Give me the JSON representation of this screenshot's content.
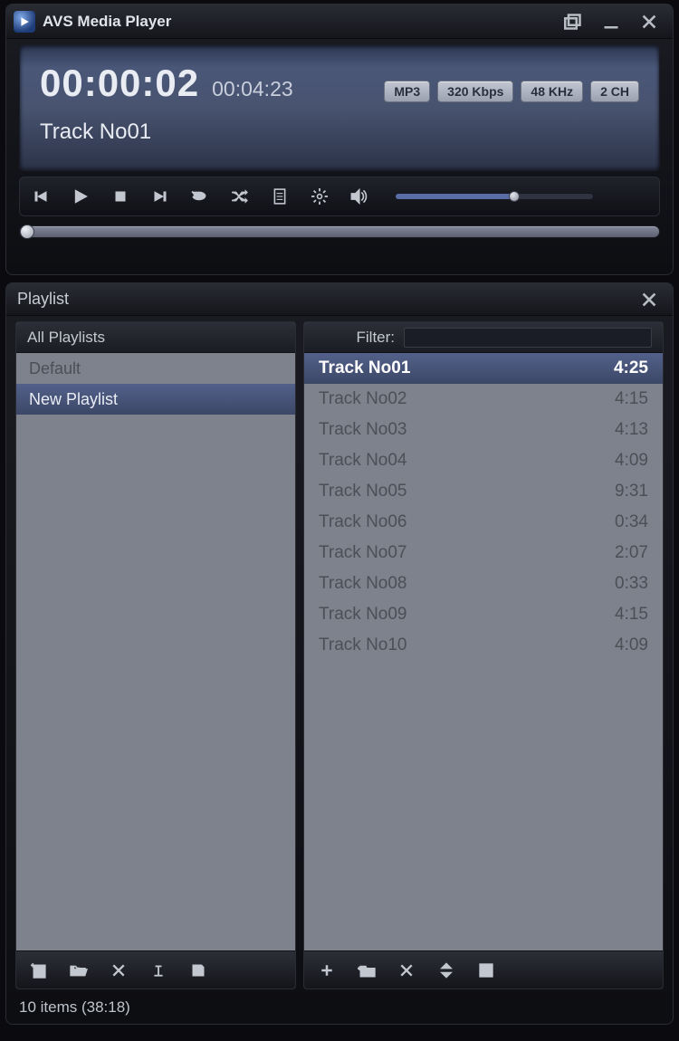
{
  "app": {
    "title": "AVS Media Player"
  },
  "player": {
    "elapsed": "00:00:02",
    "total": "00:04:23",
    "badges": [
      "MP3",
      "320 Kbps",
      "48 KHz",
      "2 CH"
    ],
    "track": "Track No01",
    "volume_pct": 60,
    "seek_pct": 1.2
  },
  "playlist": {
    "title": "Playlist",
    "left_header": "All Playlists",
    "playlists": [
      {
        "name": "Default",
        "selected": false
      },
      {
        "name": "New Playlist",
        "selected": true
      }
    ],
    "filter_label": "Filter:",
    "filter_value": "",
    "tracks": [
      {
        "name": "Track No01",
        "dur": "4:25",
        "playing": true
      },
      {
        "name": "Track No02",
        "dur": "4:15",
        "playing": false
      },
      {
        "name": "Track No03",
        "dur": "4:13",
        "playing": false
      },
      {
        "name": "Track No04",
        "dur": "4:09",
        "playing": false
      },
      {
        "name": "Track No05",
        "dur": "9:31",
        "playing": false
      },
      {
        "name": "Track No06",
        "dur": "0:34",
        "playing": false
      },
      {
        "name": "Track No07",
        "dur": "2:07",
        "playing": false
      },
      {
        "name": "Track No08",
        "dur": "0:33",
        "playing": false
      },
      {
        "name": "Track No09",
        "dur": "4:15",
        "playing": false
      },
      {
        "name": "Track No10",
        "dur": "4:09",
        "playing": false
      }
    ],
    "status": "10 items (38:18)"
  }
}
